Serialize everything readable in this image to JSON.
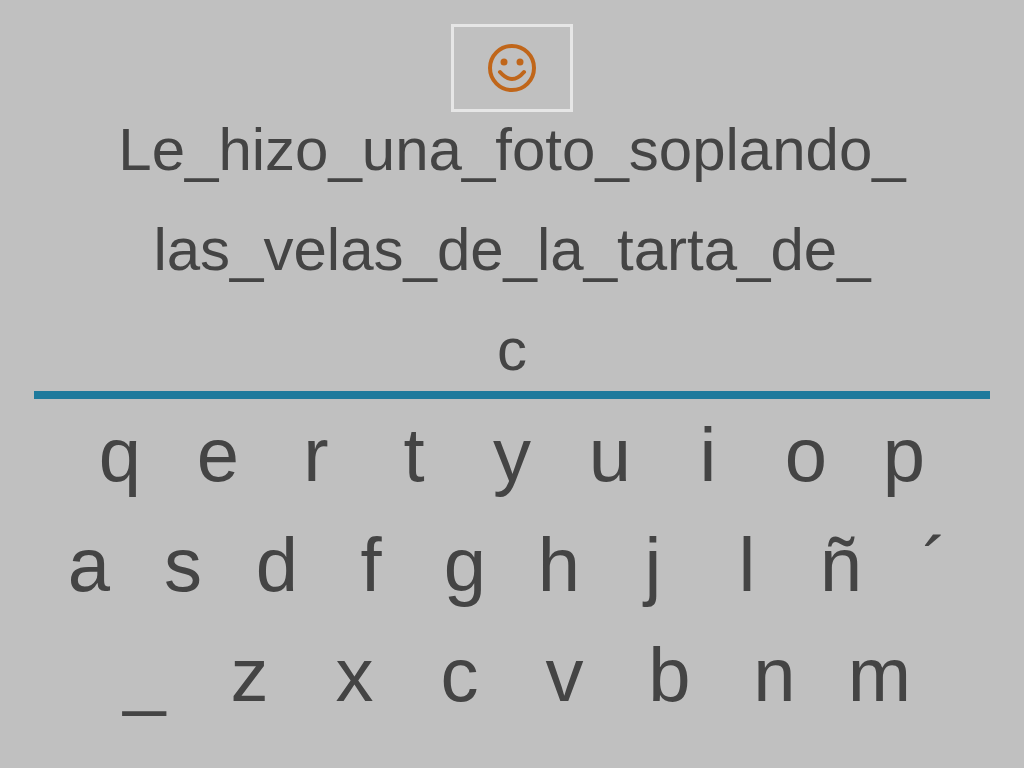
{
  "sentence_lines": [
    "Le_hizo_una_foto_soplando_",
    "las_velas_de_la_tarta_de_",
    "c"
  ],
  "keyboard_rows": [
    {
      "keys": [
        "q",
        "e",
        "r",
        "t",
        "y",
        "u",
        "i",
        "o",
        "p"
      ]
    },
    {
      "keys": [
        "a",
        "s",
        "d",
        "f",
        "g",
        "h",
        "j",
        "l",
        "ñ",
        "´"
      ]
    },
    {
      "keys": [
        "_",
        "z",
        "x",
        "c",
        "v",
        "b",
        "n",
        "m"
      ]
    }
  ]
}
